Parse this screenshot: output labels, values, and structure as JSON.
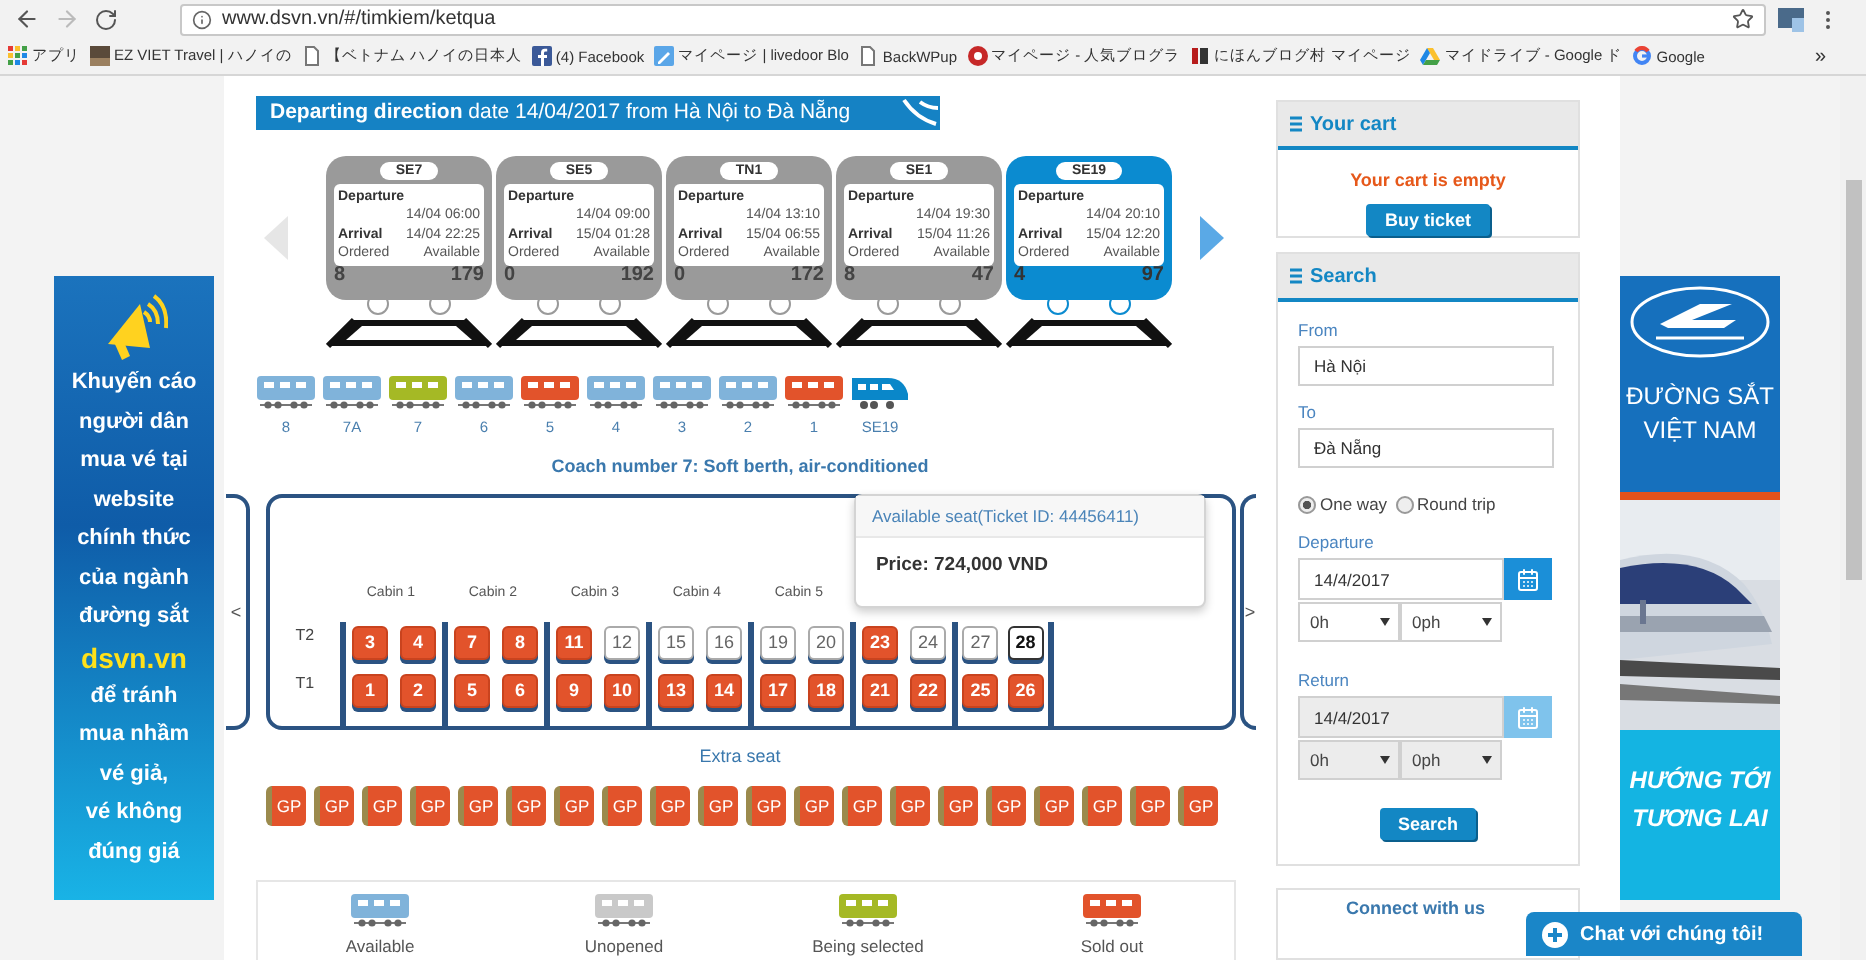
{
  "browser": {
    "url": "www.dsvn.vn/#/timkiem/ketqua",
    "bookmarks": [
      {
        "kind": "apps",
        "label": "アプリ"
      },
      {
        "kind": "thumb",
        "label": "EZ VIET Travel | ハノイの"
      },
      {
        "kind": "page",
        "label": "【ベトナム ハノイの日本人"
      },
      {
        "kind": "facebook",
        "label": "(4) Facebook"
      },
      {
        "kind": "blog",
        "label": "マイページ | livedoor Blo"
      },
      {
        "kind": "page",
        "label": "BackWPup"
      },
      {
        "kind": "ranking",
        "label": "マイページ - 人気ブログラ"
      },
      {
        "kind": "mura",
        "label": "にほんブログ村 マイページ"
      },
      {
        "kind": "drive",
        "label": "マイドライブ - Google ド"
      },
      {
        "kind": "google",
        "label": "Google"
      }
    ],
    "more": "»"
  },
  "heading": "**Departing direction** date 14/04/2017 from Hà Nội to Đà Nẵng",
  "trains": [
    {
      "code": "SE7",
      "departure_label": "Departure",
      "departure": "14/04 06:00",
      "arrival_label": "Arrival",
      "arrival": "14/04 22:25",
      "ordered_label": "Ordered",
      "available_label": "Available",
      "ordered": "8",
      "available": "179",
      "selected": false
    },
    {
      "code": "SE5",
      "departure_label": "Departure",
      "departure": "14/04 09:00",
      "arrival_label": "Arrival",
      "arrival": "15/04 01:28",
      "ordered_label": "Ordered",
      "available_label": "Available",
      "ordered": "0",
      "available": "192",
      "selected": false
    },
    {
      "code": "TN1",
      "departure_label": "Departure",
      "departure": "14/04 13:10",
      "arrival_label": "Arrival",
      "arrival": "15/04 06:55",
      "ordered_label": "Ordered",
      "available_label": "Available",
      "ordered": "0",
      "available": "172",
      "selected": false
    },
    {
      "code": "SE1",
      "departure_label": "Departure",
      "departure": "14/04 19:30",
      "arrival_label": "Arrival",
      "arrival": "15/04 11:26",
      "ordered_label": "Ordered",
      "available_label": "Available",
      "ordered": "8",
      "available": "47",
      "selected": false
    },
    {
      "code": "SE19",
      "departure_label": "Departure",
      "departure": "14/04 20:10",
      "arrival_label": "Arrival",
      "arrival": "15/04 12:20",
      "ordered_label": "Ordered",
      "available_label": "Available",
      "ordered": "4",
      "available": "97",
      "selected": true
    }
  ],
  "coaches": [
    {
      "kind": "coach",
      "label": "8",
      "color": "#80b3da"
    },
    {
      "kind": "coach",
      "label": "7A",
      "color": "#80b3da"
    },
    {
      "kind": "coach",
      "label": "7",
      "color": "#a5b925"
    },
    {
      "kind": "coach",
      "label": "6",
      "color": "#80b3da"
    },
    {
      "kind": "coach",
      "label": "5",
      "color": "#e2532b"
    },
    {
      "kind": "coach",
      "label": "4",
      "color": "#80b3da"
    },
    {
      "kind": "coach",
      "label": "3",
      "color": "#80b3da"
    },
    {
      "kind": "coach",
      "label": "2",
      "color": "#80b3da"
    },
    {
      "kind": "coach",
      "label": "1",
      "color": "#e2532b"
    },
    {
      "kind": "locomotive",
      "label": "SE19",
      "color": "#0a87c9"
    }
  ],
  "coach_title": "Coach number 7: Soft berth, air-conditioned",
  "seat_map": {
    "prev": "<",
    "next": ">",
    "row_labels": [
      "T2",
      "T1"
    ],
    "cabins": [
      {
        "label": "Cabin 1",
        "upper": [
          {
            "number": "3",
            "sold": true,
            "selected": false
          },
          {
            "number": "4",
            "sold": true,
            "selected": false
          }
        ],
        "lower": [
          {
            "number": "1",
            "sold": true,
            "selected": false
          },
          {
            "number": "2",
            "sold": true,
            "selected": false
          }
        ]
      },
      {
        "label": "Cabin 2",
        "upper": [
          {
            "number": "7",
            "sold": true,
            "selected": false
          },
          {
            "number": "8",
            "sold": true,
            "selected": false
          }
        ],
        "lower": [
          {
            "number": "5",
            "sold": true,
            "selected": false
          },
          {
            "number": "6",
            "sold": true,
            "selected": false
          }
        ]
      },
      {
        "label": "Cabin 3",
        "upper": [
          {
            "number": "11",
            "sold": true,
            "selected": false
          },
          {
            "number": "12",
            "sold": false,
            "selected": false
          }
        ],
        "lower": [
          {
            "number": "9",
            "sold": true,
            "selected": false
          },
          {
            "number": "10",
            "sold": true,
            "selected": false
          }
        ]
      },
      {
        "label": "Cabin 4",
        "upper": [
          {
            "number": "15",
            "sold": false,
            "selected": false
          },
          {
            "number": "16",
            "sold": false,
            "selected": false
          }
        ],
        "lower": [
          {
            "number": "13",
            "sold": true,
            "selected": false
          },
          {
            "number": "14",
            "sold": true,
            "selected": false
          }
        ]
      },
      {
        "label": "Cabin 5",
        "upper": [
          {
            "number": "19",
            "sold": false,
            "selected": false
          },
          {
            "number": "20",
            "sold": false,
            "selected": false
          }
        ],
        "lower": [
          {
            "number": "17",
            "sold": true,
            "selected": false
          },
          {
            "number": "18",
            "sold": true,
            "selected": false
          }
        ]
      },
      {
        "upper": [
          {
            "number": "23",
            "sold": true,
            "selected": false
          },
          {
            "number": "24",
            "sold": false,
            "selected": false
          }
        ],
        "lower": [
          {
            "number": "21",
            "sold": true,
            "selected": false
          },
          {
            "number": "22",
            "sold": true,
            "selected": false
          }
        ]
      },
      {
        "upper": [
          {
            "number": "27",
            "sold": false,
            "selected": false
          },
          {
            "number": "28",
            "sold": false,
            "selected": true
          }
        ],
        "lower": [
          {
            "number": "25",
            "sold": true,
            "selected": false
          },
          {
            "number": "26",
            "sold": true,
            "selected": false
          }
        ]
      }
    ],
    "tooltip": {
      "title": "Available seat(Ticket ID: 44456411)",
      "price": "Price: 724,000 VND"
    }
  },
  "extra_title": "Extra seat",
  "extra_seats": [
    {
      "label": "GP"
    },
    {
      "label": "GP"
    },
    {
      "label": "GP"
    },
    {
      "label": "GP"
    },
    {
      "label": "GP"
    },
    {
      "label": "GP"
    },
    {
      "label": "GP"
    },
    {
      "label": "GP"
    },
    {
      "label": "GP"
    },
    {
      "label": "GP"
    },
    {
      "label": "GP"
    },
    {
      "label": "GP"
    },
    {
      "label": "GP"
    },
    {
      "label": "GP"
    },
    {
      "label": "GP"
    },
    {
      "label": "GP"
    },
    {
      "label": "GP"
    },
    {
      "label": "GP"
    },
    {
      "label": "GP"
    },
    {
      "label": "GP"
    }
  ],
  "legend": [
    {
      "color": "#80b3da",
      "label": "Available"
    },
    {
      "color": "#c9c9c9",
      "label": "Unopened"
    },
    {
      "color": "#a5b925",
      "label": "Being selected"
    },
    {
      "color": "#e2532b",
      "label": "Sold out"
    }
  ],
  "left_ad": {
    "lines": [
      {
        "text": "Khuyến cáo",
        "highlight": false
      },
      {
        "text": "người dân",
        "highlight": false
      },
      {
        "text": "mua vé tại",
        "highlight": false
      },
      {
        "text": "website",
        "highlight": false
      },
      {
        "text": "chính thức",
        "highlight": false
      },
      {
        "text": "của ngành",
        "highlight": false
      },
      {
        "text": "đường sắt",
        "highlight": false
      },
      {
        "text": "dsvn.vn",
        "highlight": true
      },
      {
        "text": "để tránh",
        "highlight": false
      },
      {
        "text": "mua nhầm",
        "highlight": false
      },
      {
        "text": "vé giả,",
        "highlight": false
      },
      {
        "text": "vé không",
        "highlight": false
      },
      {
        "text": "đúng giá",
        "highlight": false
      }
    ]
  },
  "cart": {
    "title": "Your cart",
    "message": "Your cart is empty",
    "button": "Buy ticket"
  },
  "search": {
    "title": "Search",
    "from_label": "From",
    "from": "Hà Nội",
    "to_label": "To",
    "to": "Đà Nẵng",
    "trip_types": [
      {
        "label": "One way",
        "selected": true
      },
      {
        "label": "Round trip",
        "selected": false
      }
    ],
    "departure": {
      "label": "Departure",
      "date": "14/4/2017",
      "hour": "0h",
      "minute": "0ph",
      "disabled": false
    },
    "return": {
      "label": "Return",
      "date": "14/4/2017",
      "hour": "0h",
      "minute": "0ph",
      "disabled": true
    },
    "button": "Search"
  },
  "connect": {
    "title": "Connect with us"
  },
  "chat": "Chat với chúng tôi!",
  "right_ad": {
    "title_lines": [
      "ĐƯỜNG SẮT",
      "VIỆT NAM"
    ],
    "slogan_lines": [
      "HƯỚNG TỚI",
      "TƯƠNG LAI"
    ]
  }
}
